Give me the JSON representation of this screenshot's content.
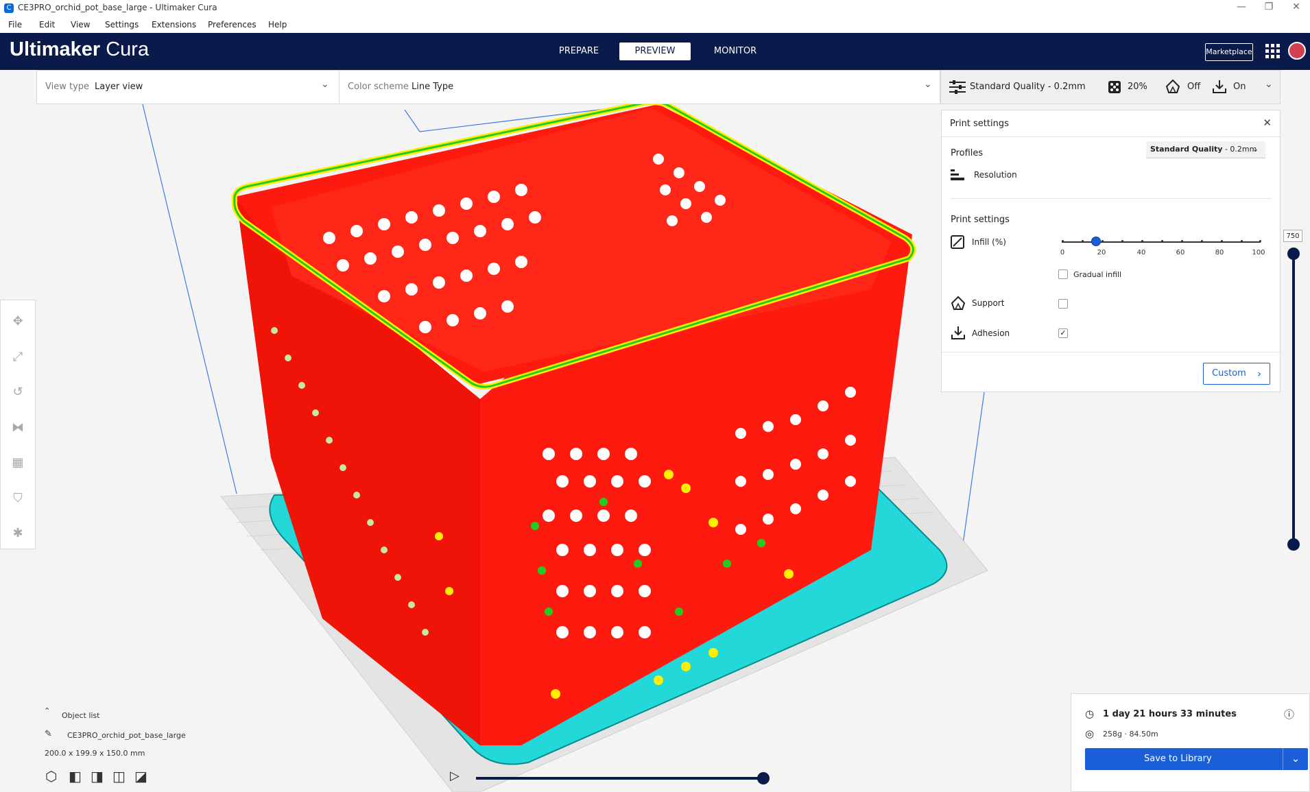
{
  "window": {
    "title": "CE3PRO_orchid_pot_base_large - Ultimaker Cura"
  },
  "menu": [
    "File",
    "Edit",
    "View",
    "Settings",
    "Extensions",
    "Preferences",
    "Help"
  ],
  "header": {
    "logo_bold": "Ultimaker",
    "logo_light": "Cura",
    "stages": [
      "PREPARE",
      "PREVIEW",
      "MONITOR"
    ],
    "active_stage": "PREVIEW",
    "marketplace": "Marketplace"
  },
  "viewbar": {
    "view_type_label": "View type",
    "view_type_value": "Layer view",
    "color_scheme_label": "Color scheme",
    "color_scheme_value": "Line Type"
  },
  "summary": {
    "quality": "Standard Quality - 0.2mm",
    "infill": "20%",
    "support": "Off",
    "adhesion": "On"
  },
  "print_panel": {
    "title": "Print settings",
    "profiles_heading": "Profiles",
    "resolution_label": "Resolution",
    "resolution_bold": "Standard Quality",
    "resolution_suffix": " - 0.2mm",
    "settings_heading": "Print settings",
    "infill_label": "Infill (%)",
    "infill_value": 20,
    "infill_ticks": [
      "0",
      "20",
      "40",
      "60",
      "80",
      "100"
    ],
    "gradual_label": "Gradual infill",
    "gradual_checked": false,
    "support_label": "Support",
    "support_checked": false,
    "adhesion_label": "Adhesion",
    "adhesion_checked": true,
    "custom_label": "Custom"
  },
  "layer_slider": {
    "top_value": "750"
  },
  "object_list": {
    "heading": "Object list",
    "object_name": "CE3PRO_orchid_pot_base_large",
    "dimensions": "200.0 x 199.9 x 150.0 mm"
  },
  "job": {
    "time": "1 day 21 hours 33 minutes",
    "material": "258g · 84.50m",
    "save_label": "Save to Library"
  },
  "colors": {
    "header_bg": "#0a1a4a",
    "accent": "#1a5fd8",
    "wall_red": "#ff1a10",
    "skin_yellow": "#ffee00",
    "inner_green": "#22cc22",
    "skirt_cyan": "#22d8d8"
  }
}
